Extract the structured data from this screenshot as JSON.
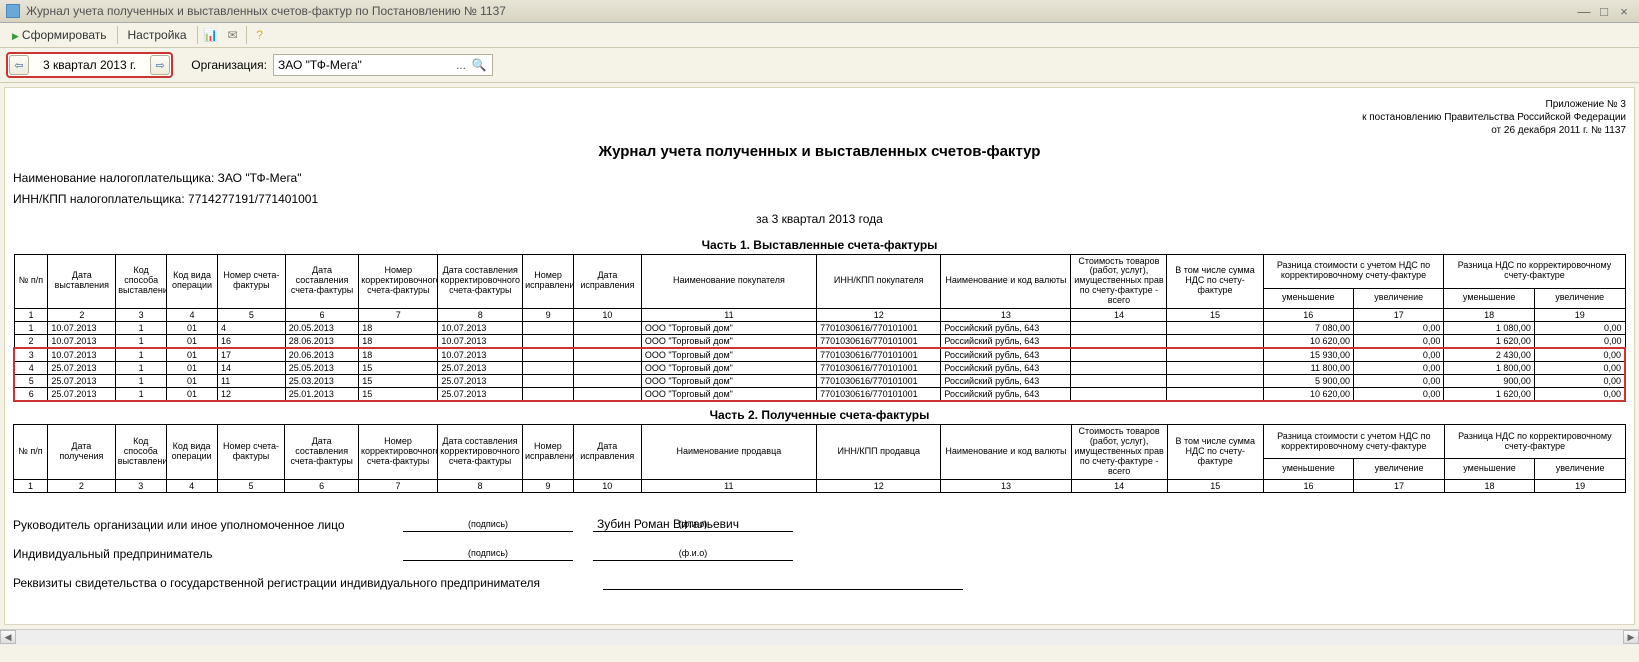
{
  "window": {
    "title": "Журнал учета полученных и выставленных счетов-фактур по Постановлению № 1137"
  },
  "toolbar": {
    "generate": "Сформировать",
    "settings": "Настройка"
  },
  "params": {
    "period": "3 квартал 2013 г.",
    "org_label": "Организация:",
    "org_value": "ЗАО \"ТФ-Мега\""
  },
  "appendix": {
    "l1": "Приложение № 3",
    "l2": "к постановлению Правительства Российской Федерации",
    "l3": "от 26 декабря 2011 г. № 1137"
  },
  "report": {
    "title": "Журнал учета полученных и выставленных счетов-фактур",
    "taxpayer_label": "Наименование налогоплательщика:",
    "taxpayer_value": "ЗАО \"ТФ-Мега\"",
    "innkpp_label": "ИНН/КПП налогоплательщика:",
    "innkpp_value": "7714277191/771401001",
    "period_text": "за 3 квартал 2013 года",
    "part1_title": "Часть 1. Выставленные счета-фактуры",
    "part2_title": "Часть 2. Полученные счета-фактуры"
  },
  "headers1": {
    "c1": "№ п/п",
    "c2": "Дата выставления",
    "c3": "Код способа выставления",
    "c4": "Код вида операции",
    "c5": "Номер счета-фактуры",
    "c6": "Дата составления счета-фактуры",
    "c7": "Номер корректировочного счета-фактуры",
    "c8": "Дата составления корректировочного счета-фактуры",
    "c9": "Номер исправления",
    "c10": "Дата исправления",
    "c11": "Наименование покупателя",
    "c12": "ИНН/КПП покупателя",
    "c13": "Наименование и код валюты",
    "c14": "Стоимость товаров (работ, услуг), имущественных прав по счету-фактуре - всего",
    "c15": "В том числе сумма НДС по счету-фактуре",
    "g16": "Разница стоимости с учетом НДС по корректировочному счету-фактуре",
    "g18": "Разница НДС по корректировочному счету-фактуре",
    "dec": "уменьшение",
    "inc": "увеличение"
  },
  "headers2": {
    "c2": "Дата получения",
    "c11": "Наименование продавца",
    "c12": "ИНН/КПП продавца"
  },
  "colnums": [
    "1",
    "2",
    "3",
    "4",
    "5",
    "6",
    "7",
    "8",
    "9",
    "10",
    "11",
    "12",
    "13",
    "14",
    "15",
    "16",
    "17",
    "18",
    "19"
  ],
  "rows1": [
    {
      "n": "1",
      "d": "10.07.2013",
      "c3": "1",
      "c4": "01",
      "c5": "4",
      "c6": "20.05.2013",
      "c7": "18",
      "c8": "10.07.2013",
      "c9": "",
      "c10": "",
      "buyer": "ООО \"Торговый дом\"",
      "inn": "7701030616/770101001",
      "cur": "Российский рубль, 643",
      "c14": "",
      "c15": "",
      "c16": "7 080,00",
      "c17": "0,00",
      "c18": "1 080,00",
      "c19": "0,00"
    },
    {
      "n": "2",
      "d": "10.07.2013",
      "c3": "1",
      "c4": "01",
      "c5": "16",
      "c6": "28.06.2013",
      "c7": "18",
      "c8": "10.07.2013",
      "c9": "",
      "c10": "",
      "buyer": "ООО \"Торговый дом\"",
      "inn": "7701030616/770101001",
      "cur": "Российский рубль, 643",
      "c14": "",
      "c15": "",
      "c16": "10 620,00",
      "c17": "0,00",
      "c18": "1 620,00",
      "c19": "0,00"
    },
    {
      "n": "3",
      "d": "10.07.2013",
      "c3": "1",
      "c4": "01",
      "c5": "17",
      "c6": "20.06.2013",
      "c7": "18",
      "c8": "10.07.2013",
      "c9": "",
      "c10": "",
      "buyer": "ООО \"Торговый дом\"",
      "inn": "7701030616/770101001",
      "cur": "Российский рубль, 643",
      "c14": "",
      "c15": "",
      "c16": "15 930,00",
      "c17": "0,00",
      "c18": "2 430,00",
      "c19": "0,00"
    },
    {
      "n": "4",
      "d": "25.07.2013",
      "c3": "1",
      "c4": "01",
      "c5": "14",
      "c6": "25.05.2013",
      "c7": "15",
      "c8": "25.07.2013",
      "c9": "",
      "c10": "",
      "buyer": "ООО \"Торговый дом\"",
      "inn": "7701030616/770101001",
      "cur": "Российский рубль, 643",
      "c14": "",
      "c15": "",
      "c16": "11 800,00",
      "c17": "0,00",
      "c18": "1 800,00",
      "c19": "0,00"
    },
    {
      "n": "5",
      "d": "25.07.2013",
      "c3": "1",
      "c4": "01",
      "c5": "11",
      "c6": "25.03.2013",
      "c7": "15",
      "c8": "25.07.2013",
      "c9": "",
      "c10": "",
      "buyer": "ООО \"Торговый дом\"",
      "inn": "7701030616/770101001",
      "cur": "Российский рубль, 643",
      "c14": "",
      "c15": "",
      "c16": "5 900,00",
      "c17": "0,00",
      "c18": "900,00",
      "c19": "0,00"
    },
    {
      "n": "6",
      "d": "25.07.2013",
      "c3": "1",
      "c4": "01",
      "c5": "12",
      "c6": "25.01.2013",
      "c7": "15",
      "c8": "25.07.2013",
      "c9": "",
      "c10": "",
      "buyer": "ООО \"Торговый дом\"",
      "inn": "7701030616/770101001",
      "cur": "Российский рубль, 643",
      "c14": "",
      "c15": "",
      "c16": "10 620,00",
      "c17": "0,00",
      "c18": "1 620,00",
      "c19": "0,00"
    }
  ],
  "sign": {
    "head_label": "Руководитель организации или иное уполномоченное лицо",
    "podpis": "(подпись)",
    "fio": "(ф.и.о)",
    "head_name": "Зубин Роман Витальевич",
    "ip_label": "Индивидуальный предприниматель",
    "rekv_label": "Реквизиты свидетельства о государственной регистрации индивидуального предпринимателя"
  }
}
